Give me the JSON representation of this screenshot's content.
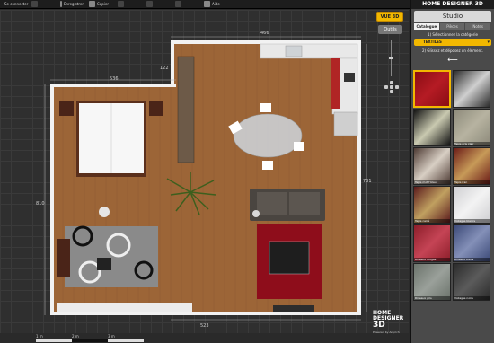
{
  "toolbar": {
    "items": [
      {
        "label": "Se connecter",
        "dim": false
      },
      {
        "label": "",
        "dim": true
      },
      {
        "label": "Enregistrer",
        "dim": false
      },
      {
        "label": "Copier",
        "dim": false
      },
      {
        "label": "",
        "dim": true
      },
      {
        "label": "",
        "dim": true
      },
      {
        "label": "",
        "dim": true
      },
      {
        "label": "Aide",
        "dim": false
      }
    ]
  },
  "plan": {
    "dimensions": {
      "top": "466",
      "wall_seg": "122",
      "left_room": "536",
      "left": "810",
      "right": "731",
      "bottom": "523"
    },
    "scale": {
      "labels": [
        "1 m",
        "2 m",
        "3 m"
      ]
    }
  },
  "controls": {
    "view3d_label": "VUE 3D",
    "tools_label": "Outils"
  },
  "logo": {
    "line1": "HOME",
    "line2": "DESIGNER",
    "line3": "3D",
    "tagline": "Powered by Anyrich"
  },
  "panel": {
    "brand": "HOME DESIGNER 3D",
    "title": "Studio",
    "tabs": [
      {
        "label": "Catalogue",
        "active": true
      },
      {
        "label": "Pièces",
        "active": false
      },
      {
        "label": "Notes",
        "active": false
      }
    ],
    "step1": "1) Sélectionnez la catégorie",
    "category": "TEXTILES",
    "step2": "2) Glissez et déposez un élément.",
    "tiles": [
      {
        "caption": "",
        "colors": [
          "#8a0d14",
          "#b51b24"
        ],
        "selected": true
      },
      {
        "caption": "",
        "colors": [
          "#2c2c2c",
          "#cfcfcf"
        ],
        "selected": false
      },
      {
        "caption": "",
        "colors": [
          "#111111",
          "#c9c9b0"
        ],
        "selected": false
      },
      {
        "caption": "Tapis gris clair",
        "colors": [
          "#8d8a7a",
          "#b7b3a1"
        ],
        "selected": false
      },
      {
        "caption": "Tapis motif bleu",
        "colors": [
          "#4d3a33",
          "#d8cfc4"
        ],
        "selected": false
      },
      {
        "caption": "Tapis iran",
        "colors": [
          "#6b1b17",
          "#c79a58"
        ],
        "selected": false
      },
      {
        "caption": "Tapis carré",
        "colors": [
          "#5a1a1c",
          "#c0a060"
        ],
        "selected": false
      },
      {
        "caption": "Voilages blancs",
        "colors": [
          "#cfcfd2",
          "#f3f3f3"
        ],
        "selected": false
      },
      {
        "caption": "Rideaux rouges",
        "colors": [
          "#8d1e2a",
          "#c54455"
        ],
        "selected": false
      },
      {
        "caption": "Rideaux bleus",
        "colors": [
          "#3c4a78",
          "#8490b8"
        ],
        "selected": false
      },
      {
        "caption": "Rideaux gris",
        "colors": [
          "#6b736b",
          "#9aa09a"
        ],
        "selected": false
      },
      {
        "caption": "Voilages noirs",
        "colors": [
          "#2b2b2b",
          "#5b5b5b"
        ],
        "selected": false
      }
    ]
  },
  "colors": {
    "accent": "#f2b800",
    "floor": "#9c6537",
    "wall": "#f2f2f2",
    "rug_red": "#8e0d1b"
  }
}
